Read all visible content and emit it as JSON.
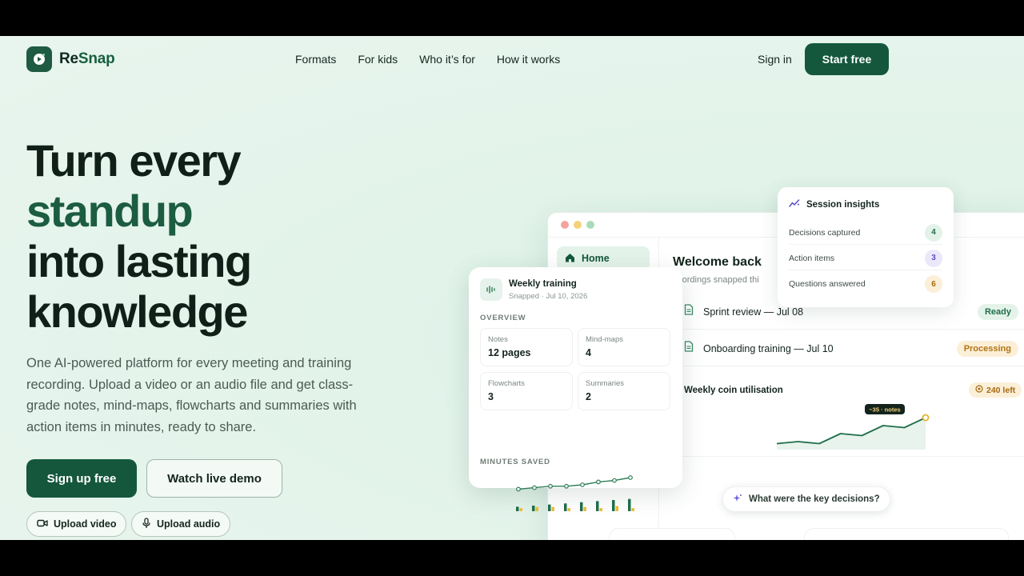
{
  "brand": {
    "name_prefix": "Re",
    "name_suffix": "Snap"
  },
  "nav": {
    "links": [
      "Formats",
      "For kids",
      "Who it’s for",
      "How it works"
    ],
    "signin": "Sign in",
    "start": "Start free"
  },
  "hero": {
    "line1": "Turn every",
    "line2": "standup",
    "line3": "into lasting",
    "line4": "knowledge",
    "subtitle": "One AI-powered platform for every meeting and training recording. Upload a video or an audio file and get class-grade notes, mind-maps, flowcharts and summaries with action items in minutes, ready to share.",
    "cta_primary": "Sign up free",
    "cta_secondary": "Watch live demo",
    "chip_video": "Upload video",
    "chip_audio": "Upload audio"
  },
  "app": {
    "home": "Home",
    "welcome": "Welcome back",
    "welcome_sub": "ecordings snapped thi",
    "recordings": [
      {
        "title": "Sprint review — Jul 08",
        "status": "Ready"
      },
      {
        "title": "Onboarding training — Jul 10",
        "status": "Processing"
      }
    ],
    "coin_title": "Weekly coin utilisation",
    "coin_left": "240 left",
    "coin_tooltip": "~35 · notes",
    "coin_series": [
      3,
      4,
      3,
      8,
      7,
      12,
      11,
      16
    ],
    "ask": "What were the key decisions?"
  },
  "insights": {
    "title": "Session insights",
    "rows": [
      {
        "label": "Decisions captured",
        "value": "4",
        "color": "#e3f2e9",
        "text_color": "#1f6e4a"
      },
      {
        "label": "Action items",
        "value": "3",
        "color": "#ebe8fb",
        "text_color": "#5a4fc0"
      },
      {
        "label": "Questions answered",
        "value": "6",
        "color": "#fcefd8",
        "text_color": "#a56a12"
      }
    ]
  },
  "training": {
    "title": "Weekly training",
    "subtitle": "Snapped · Jul 10, 2026",
    "overview_label": "OVERVIEW",
    "stats": [
      {
        "label": "Notes",
        "value": "12 pages"
      },
      {
        "label": "Mind-maps",
        "value": "4"
      },
      {
        "label": "Flowcharts",
        "value": "3"
      },
      {
        "label": "Summaries",
        "value": "2"
      }
    ],
    "minutes_label": "MINUTES SAVED",
    "minutes_line": [
      2,
      3,
      4,
      4,
      5,
      7,
      8,
      10
    ],
    "bars_green": [
      4,
      5,
      6,
      7,
      8,
      9,
      10,
      11
    ],
    "bars_yellow": [
      3,
      4,
      4,
      3,
      4,
      3,
      5,
      3
    ]
  },
  "colors": {
    "brand": "#14573d",
    "accent_green": "#1c5c41",
    "page_bg": "#e6f4ec"
  }
}
